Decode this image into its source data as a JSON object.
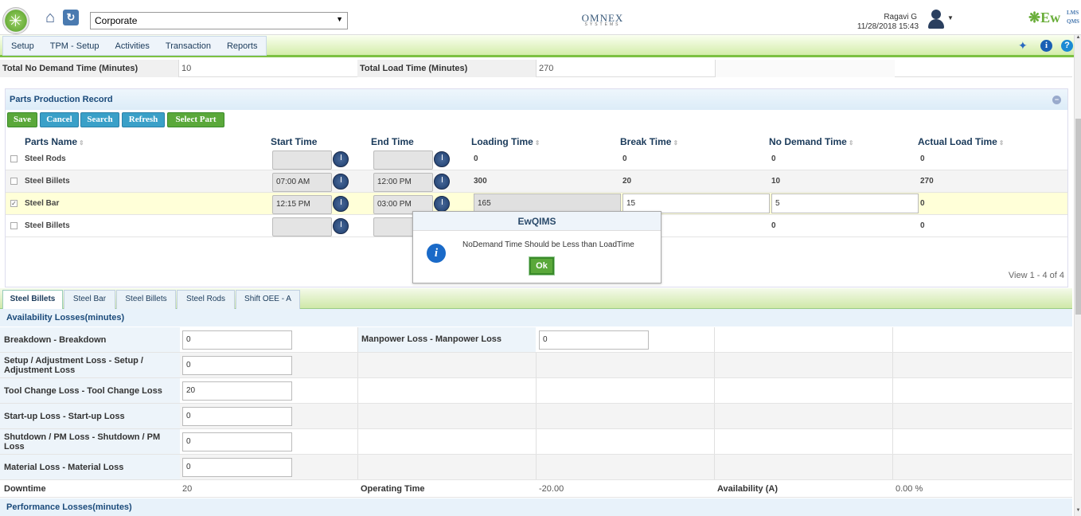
{
  "header": {
    "organization": "Corporate",
    "vendor_logo": "OMNEX",
    "vendor_logo_sub": "SYSTEMS",
    "user_name": "Ragavi G",
    "datetime": "11/28/2018 15:43",
    "product_logo": "EwQIMS",
    "product_logo_main": "Ew",
    "product_logo_sup": "LMS",
    "product_logo_sub": "QMS"
  },
  "menu": {
    "items": [
      "Setup",
      "TPM - Setup",
      "Activities",
      "Transaction",
      "Reports"
    ]
  },
  "icons": {
    "home": "home-icon",
    "refresh": "refresh-icon",
    "pin": "pin-icon",
    "info": "info-icon",
    "help": "help-icon",
    "clock": "clock-icon"
  },
  "summary": {
    "no_demand_label": "Total No Demand Time (Minutes)",
    "no_demand_value": "10",
    "load_label": "Total Load Time (Minutes)",
    "load_value": "270"
  },
  "parts": {
    "title": "Parts Production Record",
    "buttons": {
      "save": "Save",
      "cancel": "Cancel",
      "search": "Search",
      "refresh": "Refresh",
      "select_part": "Select Part"
    },
    "columns": [
      "Parts Name",
      "Start Time",
      "End Time",
      "Loading Time",
      "Break Time",
      "No Demand Time",
      "Actual Load Time"
    ],
    "rows": [
      {
        "name": "Steel Rods",
        "start": "",
        "end": "",
        "loading": "0",
        "break": "0",
        "no_demand": "0",
        "actual": "0",
        "checked": false
      },
      {
        "name": "Steel Billets",
        "start": "07:00 AM",
        "end": "12:00 PM",
        "loading": "300",
        "break": "20",
        "no_demand": "10",
        "actual": "270",
        "checked": false
      },
      {
        "name": "Steel Bar",
        "start": "12:15 PM",
        "end": "03:00 PM",
        "loading": "165",
        "break": "15",
        "no_demand": "5",
        "actual": "0",
        "checked": true
      },
      {
        "name": "Steel Billets",
        "start": "",
        "end": "",
        "loading": "",
        "break": "",
        "no_demand": "0",
        "actual": "0",
        "checked": false
      }
    ],
    "pager": "View 1 - 4 of 4"
  },
  "modal": {
    "title": "EwQIMS",
    "message": "NoDemand Time Should be Less than LoadTime",
    "ok": "Ok"
  },
  "tabs": [
    "Steel Billets",
    "Steel Bar",
    "Steel Billets",
    "Steel Rods",
    "Shift OEE - A"
  ],
  "availability": {
    "title": "Availability Losses(minutes)",
    "rows": [
      {
        "label": "Breakdown - Breakdown",
        "value": "0"
      },
      {
        "label": "Setup / Adjustment Loss - Setup / Adjustment Loss",
        "value": "0"
      },
      {
        "label": "Tool Change Loss - Tool Change Loss",
        "value": "20"
      },
      {
        "label": "Start-up Loss - Start-up Loss",
        "value": "0"
      },
      {
        "label": "Shutdown / PM Loss - Shutdown / PM Loss",
        "value": "0"
      },
      {
        "label": "Material Loss - Material Loss",
        "value": "0"
      }
    ],
    "manpower_label": "Manpower Loss - Manpower Loss",
    "manpower_value": "0",
    "downtime_label": "Downtime",
    "downtime_value": "20",
    "operating_label": "Operating Time",
    "operating_value": "-20.00",
    "availability_label": "Availability (A)",
    "availability_value": "0.00 %"
  },
  "performance": {
    "title": "Performance Losses(minutes)"
  },
  "colors": {
    "menu_accent": "#7cc142",
    "button_green": "#5aa83a",
    "button_blue": "#3aa0c8",
    "title_blue": "#1a4a7a",
    "selected_row": "#ffffd8"
  }
}
